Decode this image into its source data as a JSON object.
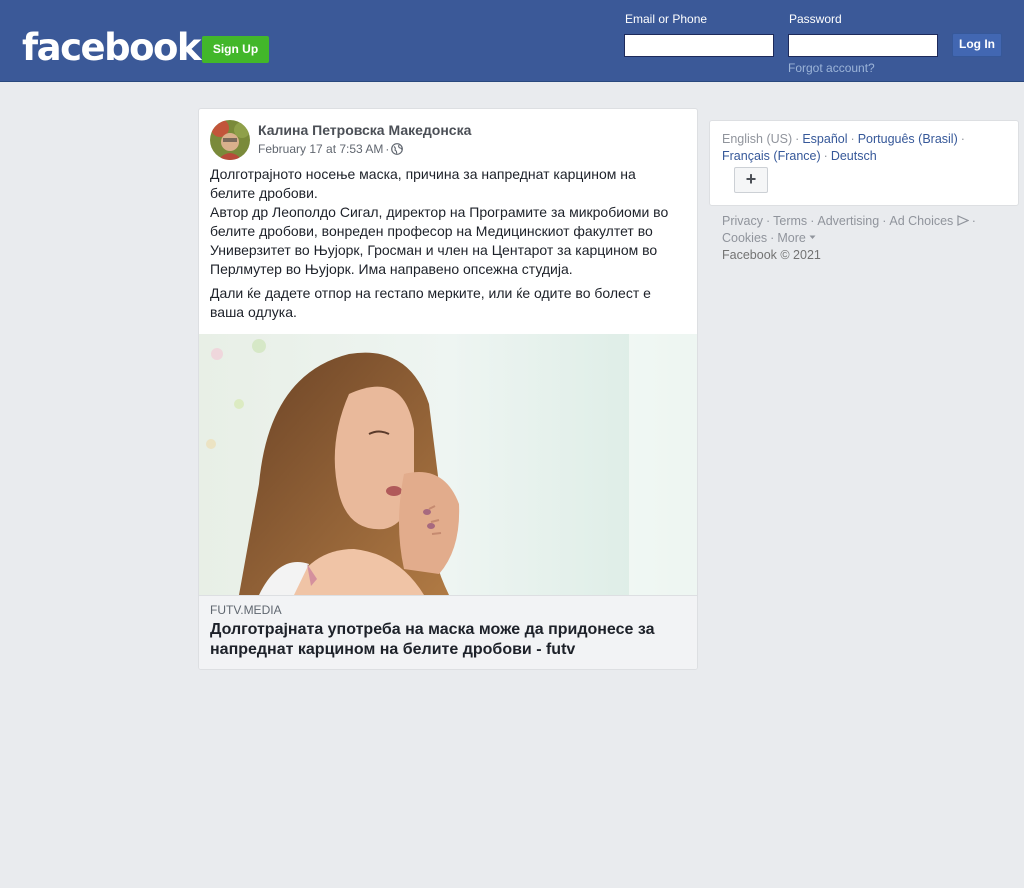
{
  "header": {
    "logo": "facebook",
    "signup_label": "Sign Up",
    "email_label": "Email or Phone",
    "password_label": "Password",
    "login_label": "Log In",
    "forgot_link": "Forgot account?"
  },
  "post": {
    "author": "Калина Петровска Македонска",
    "timestamp": "February 17 at 7:53 AM",
    "timestamp_separator": "·",
    "privacy_icon": "globe-icon",
    "paragraphs": [
      "Долготрајното носење маска, причина за напреднат карцином на белите дробови.\nАвтор др Леополдо Сигал, директор на Програмите за микробиоми во белите дробови, вонреден професор на Медицинскиот факултет во Универзитет во Њујорк, Гросман и член на Центарот за карцином во Перлмутер во Њујорк. Има направено опсежна студија.",
      "Дали ќе дадете отпор на гестапо мерките, или ќе одите во болест е ваша одлука."
    ],
    "link": {
      "source": "FUTV.MEDIA",
      "title": "Долготрајната употреба на маска може да придонесе за напреднат карцином на белите дробови - futv"
    }
  },
  "sidebar": {
    "languages": {
      "current": "English (US)",
      "links": [
        "Español",
        "Português (Brasil)",
        "Français (France)",
        "Deutsch"
      ],
      "more_button": "+"
    },
    "footer_links": [
      "Privacy",
      "Terms",
      "Advertising",
      "Ad Choices",
      "Cookies",
      "More"
    ],
    "copyright": "Facebook © 2021"
  },
  "colors": {
    "brand_blue": "#3b5998",
    "signup_green": "#42b72a",
    "page_background": "#e9ebee",
    "link_blue": "#365899"
  }
}
